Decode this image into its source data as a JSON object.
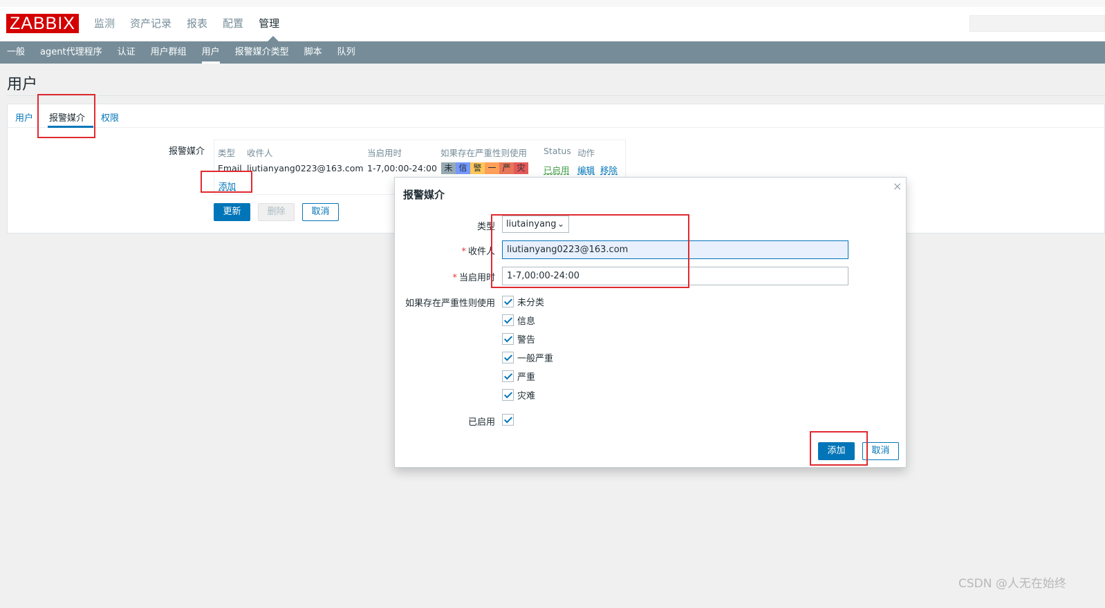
{
  "header": {
    "logo": "ZABBIX",
    "nav": [
      "监测",
      "资产记录",
      "报表",
      "配置",
      "管理"
    ],
    "active_nav": "管理"
  },
  "subnav": {
    "items": [
      "一般",
      "agent代理程序",
      "认证",
      "用户群组",
      "用户",
      "报警媒介类型",
      "脚本",
      "队列"
    ],
    "active": "用户"
  },
  "page": {
    "title": "用户"
  },
  "tabs": [
    "用户",
    "报警媒介",
    "权限"
  ],
  "media": {
    "label": "报警媒介",
    "headers": [
      "类型",
      "收件人",
      "当启用时",
      "如果存在严重性则使用",
      "Status",
      "动作"
    ],
    "row": {
      "type": "Email",
      "recipient": "liutianyang0223@163.com",
      "when_active": "1-7,00:00-24:00",
      "severities": [
        {
          "label": "未",
          "color": "#97aab3"
        },
        {
          "label": "信",
          "color": "#7499ff"
        },
        {
          "label": "警",
          "color": "#ffc859"
        },
        {
          "label": "一",
          "color": "#ffa059"
        },
        {
          "label": "严",
          "color": "#e97659"
        },
        {
          "label": "灾",
          "color": "#e45959"
        }
      ],
      "status": "已启用",
      "edit": "编辑",
      "remove": "移除"
    },
    "add_link": "添加"
  },
  "form_buttons": {
    "update": "更新",
    "delete": "删除",
    "cancel": "取消"
  },
  "dialog": {
    "title": "报警媒介",
    "close": "×",
    "type_label": "类型",
    "type_value": "liutainyang",
    "recipient_label": "收件人",
    "recipient_value": "liutianyang0223@163.com",
    "when_label": "当启用时",
    "when_value": "1-7,00:00-24:00",
    "severity_label": "如果存在严重性则使用",
    "severities": [
      "未分类",
      "信息",
      "警告",
      "一般严重",
      "严重",
      "灾难"
    ],
    "enabled_label": "已启用",
    "add_button": "添加",
    "cancel_button": "取消"
  },
  "watermark": "CSDN @人无在始终",
  "colors": {
    "accent": "#0275b8",
    "nav_bar": "#768d99",
    "logo": "#d40000",
    "highlight_box": "#e0282e"
  }
}
